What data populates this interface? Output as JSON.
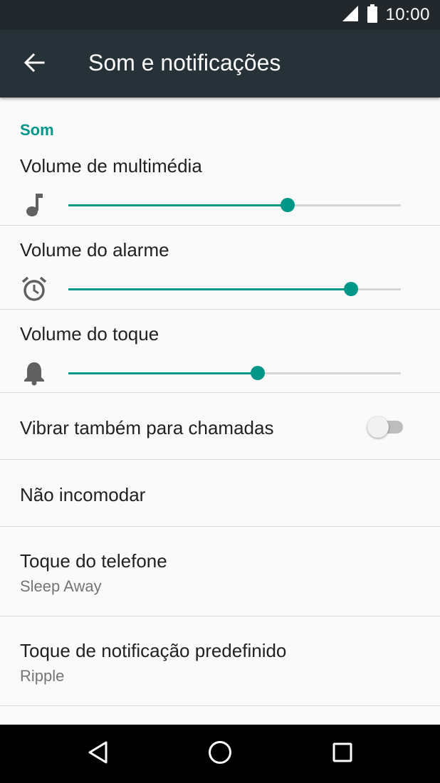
{
  "status_bar": {
    "time": "10:00",
    "icons": [
      "signal-icon",
      "battery-icon"
    ]
  },
  "toolbar": {
    "title": "Som e notificações",
    "back_icon": "arrow-back-icon"
  },
  "section": {
    "header": "Som"
  },
  "volumes": [
    {
      "label": "Volume de multimédia",
      "icon": "music-note-icon",
      "level_fraction": 0.66
    },
    {
      "label": "Volume do alarme",
      "icon": "alarm-clock-icon",
      "level_fraction": 0.85
    },
    {
      "label": "Volume do toque",
      "icon": "bell-icon",
      "level_fraction": 0.57
    }
  ],
  "preferences": {
    "vibrate": {
      "title": "Vibrar também para chamadas",
      "enabled": false
    },
    "dnd": {
      "title": "Não incomodar"
    },
    "ringtone": {
      "title": "Toque do telefone",
      "value": "Sleep Away"
    },
    "notification_tone": {
      "title": "Toque de notificação predefinido",
      "value": "Ripple"
    }
  },
  "nav_bar": {
    "icons": [
      "back-triangle-icon",
      "home-circle-icon",
      "recents-square-icon"
    ]
  },
  "colors": {
    "accent": "#009688",
    "toolbar": "#263238",
    "status_bar": "#21272b",
    "background": "#fafafa"
  }
}
